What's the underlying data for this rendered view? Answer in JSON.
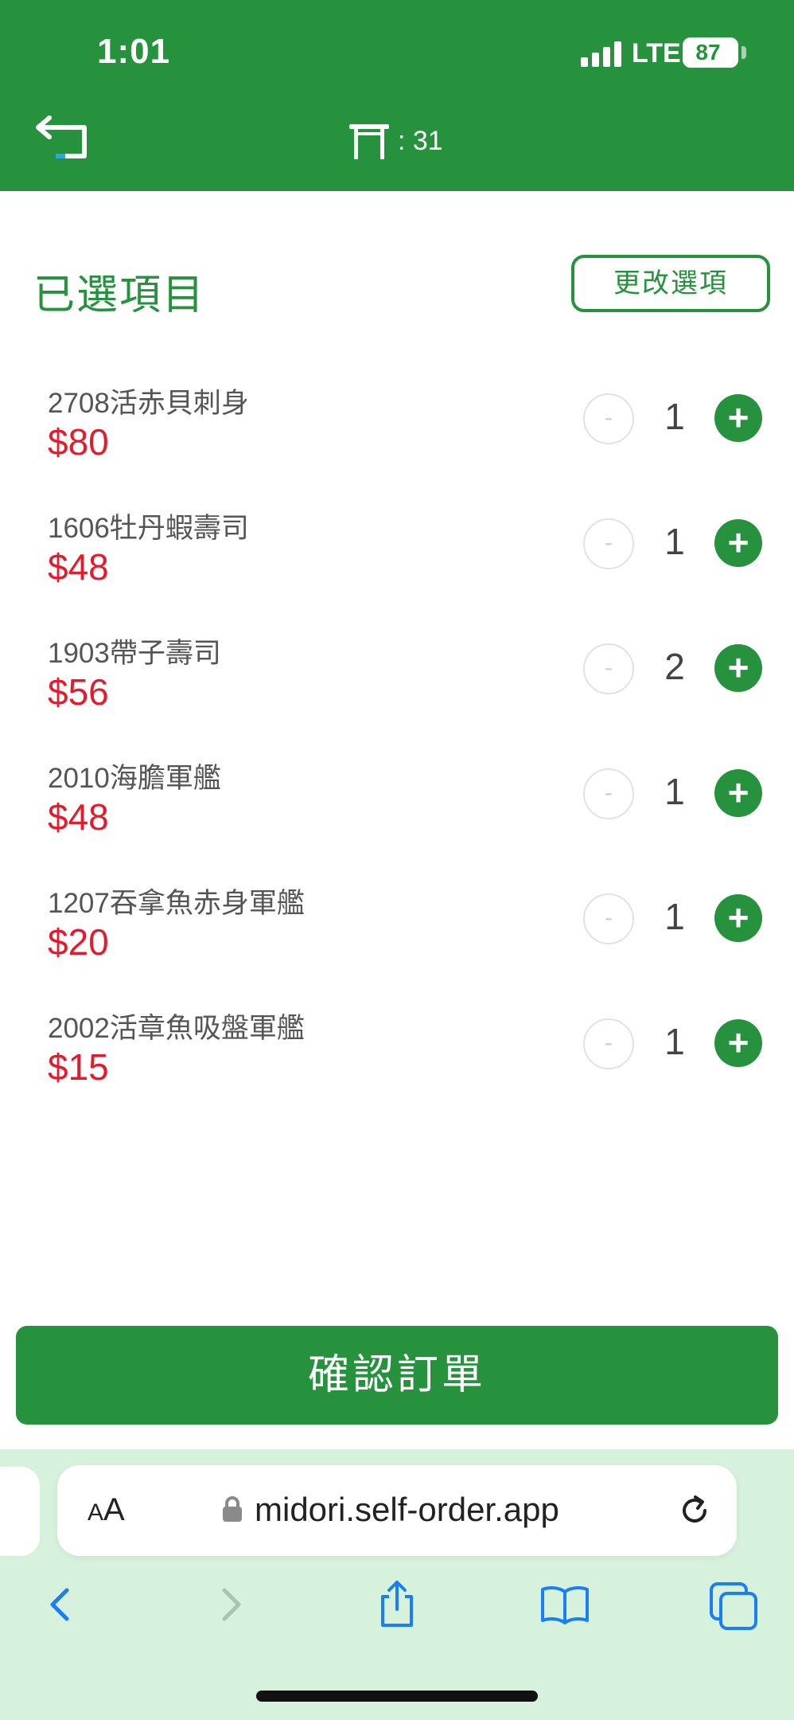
{
  "status_bar": {
    "time": "1:01",
    "network": "LTE",
    "battery": "87"
  },
  "header": {
    "table_label": ": 31"
  },
  "section": {
    "title": "已選項目",
    "change_button": "更改選項"
  },
  "items": [
    {
      "name": "2708活赤貝刺身",
      "price": "$80",
      "qty": "1"
    },
    {
      "name": "1606牡丹蝦壽司",
      "price": "$48",
      "qty": "1"
    },
    {
      "name": "1903帶子壽司",
      "price": "$56",
      "qty": "2"
    },
    {
      "name": "2010海膽軍艦",
      "price": "$48",
      "qty": "1"
    },
    {
      "name": "1207吞拿魚赤身軍艦",
      "price": "$20",
      "qty": "1"
    },
    {
      "name": "2002活章魚吸盤軍艦",
      "price": "$15",
      "qty": "1"
    }
  ],
  "stepper": {
    "minus": "-",
    "plus": "+"
  },
  "confirm_button": "確認訂單",
  "browser": {
    "aa_small": "A",
    "aa_large": "A",
    "url": "midori.self-order.app"
  },
  "colors": {
    "brand_green": "#27923d",
    "price_red": "#e41b2c",
    "browser_bg": "#d6f1dc",
    "ios_blue": "#1a7ef7"
  }
}
